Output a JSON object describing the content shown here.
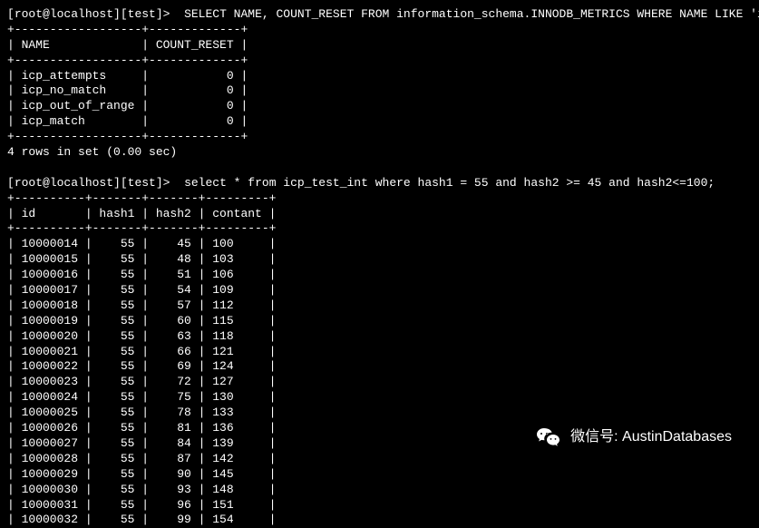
{
  "prompt1": {
    "user": "root@localhost",
    "db": "test",
    "sql": "SELECT NAME, COUNT_RESET FROM information_schema.INNODB_METRICS WHERE NAME LIKE 'icp%';"
  },
  "table1": {
    "divider": "+------------------+-------------+",
    "header_name": "NAME",
    "header_count": "COUNT_RESET",
    "rows": [
      {
        "name": "icp_attempts",
        "count": "0"
      },
      {
        "name": "icp_no_match",
        "count": "0"
      },
      {
        "name": "icp_out_of_range",
        "count": "0"
      },
      {
        "name": "icp_match",
        "count": "0"
      }
    ]
  },
  "result1": "4 rows in set (0.00 sec)",
  "prompt2": {
    "user": "root@localhost",
    "db": "test",
    "sql": "select * from icp_test_int where hash1 = 55 and hash2 >= 45 and hash2<=100;"
  },
  "table2": {
    "divider": "+----------+-------+-------+---------+",
    "headers": {
      "id": "id",
      "hash1": "hash1",
      "hash2": "hash2",
      "contant": "contant"
    },
    "rows": [
      {
        "id": "10000014",
        "hash1": "55",
        "hash2": "45",
        "contant": "100"
      },
      {
        "id": "10000015",
        "hash1": "55",
        "hash2": "48",
        "contant": "103"
      },
      {
        "id": "10000016",
        "hash1": "55",
        "hash2": "51",
        "contant": "106"
      },
      {
        "id": "10000017",
        "hash1": "55",
        "hash2": "54",
        "contant": "109"
      },
      {
        "id": "10000018",
        "hash1": "55",
        "hash2": "57",
        "contant": "112"
      },
      {
        "id": "10000019",
        "hash1": "55",
        "hash2": "60",
        "contant": "115"
      },
      {
        "id": "10000020",
        "hash1": "55",
        "hash2": "63",
        "contant": "118"
      },
      {
        "id": "10000021",
        "hash1": "55",
        "hash2": "66",
        "contant": "121"
      },
      {
        "id": "10000022",
        "hash1": "55",
        "hash2": "69",
        "contant": "124"
      },
      {
        "id": "10000023",
        "hash1": "55",
        "hash2": "72",
        "contant": "127"
      },
      {
        "id": "10000024",
        "hash1": "55",
        "hash2": "75",
        "contant": "130"
      },
      {
        "id": "10000025",
        "hash1": "55",
        "hash2": "78",
        "contant": "133"
      },
      {
        "id": "10000026",
        "hash1": "55",
        "hash2": "81",
        "contant": "136"
      },
      {
        "id": "10000027",
        "hash1": "55",
        "hash2": "84",
        "contant": "139"
      },
      {
        "id": "10000028",
        "hash1": "55",
        "hash2": "87",
        "contant": "142"
      },
      {
        "id": "10000029",
        "hash1": "55",
        "hash2": "90",
        "contant": "145"
      },
      {
        "id": "10000030",
        "hash1": "55",
        "hash2": "93",
        "contant": "148"
      },
      {
        "id": "10000031",
        "hash1": "55",
        "hash2": "96",
        "contant": "151"
      },
      {
        "id": "10000032",
        "hash1": "55",
        "hash2": "99",
        "contant": "154"
      }
    ]
  },
  "watermark": {
    "label": "微信号",
    "value": "AustinDatabases"
  }
}
